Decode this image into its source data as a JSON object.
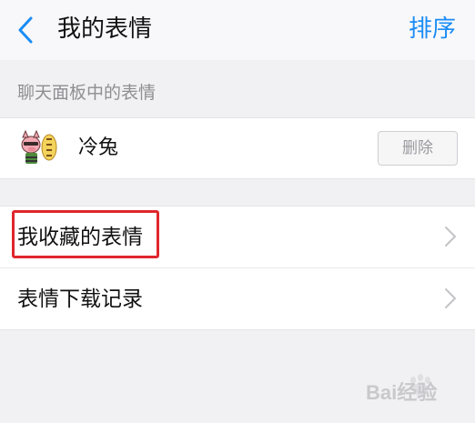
{
  "navbar": {
    "title": "我的表情",
    "action_label": "排序"
  },
  "section_header": "聊天面板中的表情",
  "packs": [
    {
      "name": "冷兔",
      "delete_label": "删除"
    }
  ],
  "menu": {
    "items": [
      {
        "label": "我收藏的表情"
      },
      {
        "label": "表情下载记录"
      }
    ]
  },
  "annotation": {
    "highlight_color": "#e0262c"
  },
  "colors": {
    "accent": "#1a8cf5",
    "background": "#f1f1f3",
    "row_background": "#ffffff",
    "muted_text": "#8e8e93"
  },
  "watermark": {
    "text": "Bai经验"
  }
}
